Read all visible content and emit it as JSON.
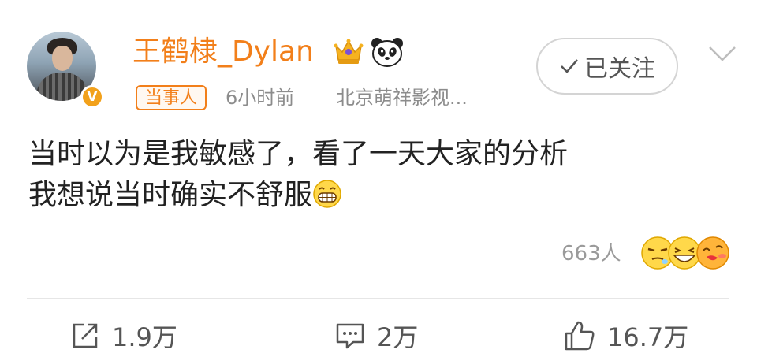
{
  "post": {
    "author": "王鹤棣_Dylan",
    "verified_badge": "V",
    "tag": "当事人",
    "time": "6小时前",
    "source": "北京萌祥影视...",
    "follow_label": "已关注",
    "text_line1": "当时以为是我敏感了，看了一天大家的分析",
    "text_line2": "我想说当时确实不舒服",
    "reaction_count": "663人"
  },
  "actions": {
    "repost_count": "1.9万",
    "comment_count": "2万",
    "like_count": "16.7万"
  },
  "colors": {
    "accent": "#f27f1a",
    "muted": "#8c8c8c",
    "verified": "#f2a11b"
  },
  "icons": [
    "crown-icon",
    "panda-icon",
    "check-icon",
    "chevron-down-icon",
    "grin-emoji-icon",
    "repost-icon",
    "comment-icon",
    "like-icon"
  ]
}
